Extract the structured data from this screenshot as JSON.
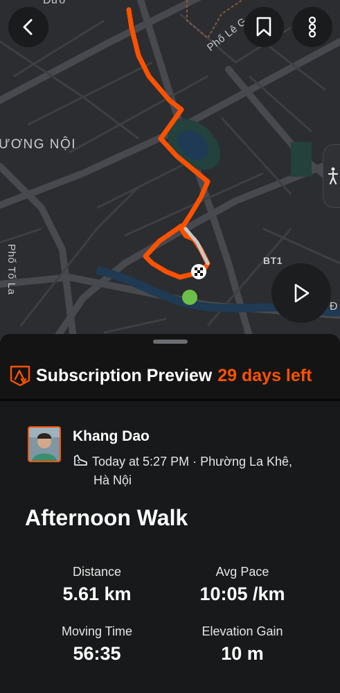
{
  "map": {
    "labels": {
      "top_partial": "Đườ",
      "street_le": "Phố Lê G",
      "district": "ƯƠNG NỘI",
      "street_to_la": "Phố Tố La",
      "bt1": "BT1",
      "edge": "Đ"
    },
    "route_color": "#fc5200",
    "icons": {
      "back": "chevron-left-icon",
      "bookmark": "bookmark-icon",
      "more": "more-vertical-icon",
      "play": "play-icon",
      "walker": "walker-icon",
      "finish": "checkered-flag-icon",
      "start": "start-dot-icon"
    }
  },
  "subscription": {
    "title": "Subscription Preview",
    "days_left": "29 days left"
  },
  "activity": {
    "athlete": "Khang Dao",
    "time_location_1": "Today at 5:27 PM · Phường La Khê,",
    "time_location_2": "Hà Nội",
    "title": "Afternoon Walk",
    "stats": [
      {
        "label": "Distance",
        "value": "5.61 km"
      },
      {
        "label": "Avg Pace",
        "value": "10:05 /km"
      },
      {
        "label": "Moving Time",
        "value": "56:35"
      },
      {
        "label": "Elevation Gain",
        "value": "10 m"
      }
    ]
  },
  "colors": {
    "accent": "#fc5200",
    "background": "#141414",
    "start_dot": "#6cc04a"
  }
}
